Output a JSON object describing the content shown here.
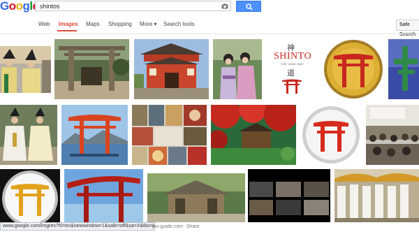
{
  "logo": {
    "letters": [
      "G",
      "o",
      "o",
      "g",
      "l",
      "e"
    ],
    "colors": [
      "#3369e8",
      "#d50f25",
      "#eeb211",
      "#3369e8",
      "#009925",
      "#d50f25"
    ]
  },
  "search": {
    "query": "shintos"
  },
  "nav": {
    "items": [
      {
        "label": "Web",
        "active": false
      },
      {
        "label": "Images",
        "active": true
      },
      {
        "label": "Maps",
        "active": false
      },
      {
        "label": "Shopping",
        "active": false
      },
      {
        "label": "More ▾",
        "active": false
      },
      {
        "label": "Search tools",
        "active": false
      }
    ],
    "safe_search_label": "Safe Search"
  },
  "results": {
    "shinto_card": {
      "title": "SHINTO",
      "subtitle": "THE KAMI WAY",
      "kanji_top": "神",
      "kanji_bottom": "道"
    },
    "domain_caption": "jan-guide.com",
    "domain_caption_suffix": "Share"
  },
  "status_bar": {
    "url": "www.google.com/imgres?hl=en&newwindow=1&safe=off&sa=X&tbo=d&b..."
  },
  "colors": {
    "accent": "#dd4b39",
    "search_button": "#4d90fe",
    "torii_red": "#c8281e"
  }
}
